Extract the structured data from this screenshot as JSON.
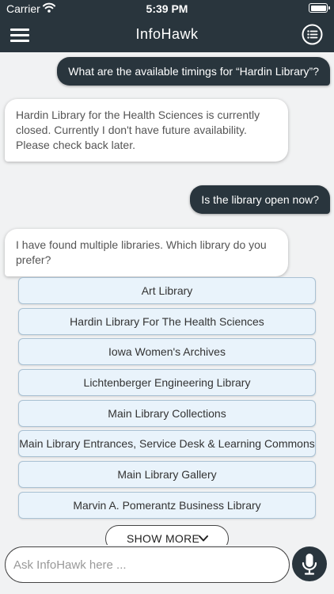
{
  "status_bar": {
    "carrier": "Carrier",
    "time": "5:39 PM"
  },
  "header": {
    "title": "InfoHawk"
  },
  "messages": [
    {
      "sender": "user",
      "text": "What are the available timings for “Hardin Library”?"
    },
    {
      "sender": "bot",
      "text": "Hardin Library for the Health Sciences is currently closed. Currently I don't have future availability. Please check back later."
    },
    {
      "sender": "user",
      "text": "Is the library open now?"
    },
    {
      "sender": "bot",
      "text": "I have found multiple libraries. Which library do you prefer?"
    }
  ],
  "library_options": [
    "Art Library",
    "Hardin Library For The Health Sciences",
    "Iowa Women's Archives",
    "Lichtenberger Engineering Library",
    "Main Library Collections",
    "Main Library Entrances, Service Desk & Learning Commons",
    "Main Library Gallery",
    "Marvin A. Pomerantz Business Library"
  ],
  "show_more_label": "SHOW MORE",
  "input": {
    "placeholder": "Ask InfoHawk here ...",
    "value": ""
  },
  "colors": {
    "primary": "#29353d",
    "option_bg": "#e9f3fb",
    "option_border": "#a9c1d3",
    "background": "#f1f2f3"
  },
  "icons": {
    "menu": "hamburger-menu-icon",
    "list": "list-menu-icon",
    "mic": "microphone-icon",
    "chevron": "chevron-down-icon",
    "wifi": "wifi-icon",
    "battery": "battery-icon"
  }
}
